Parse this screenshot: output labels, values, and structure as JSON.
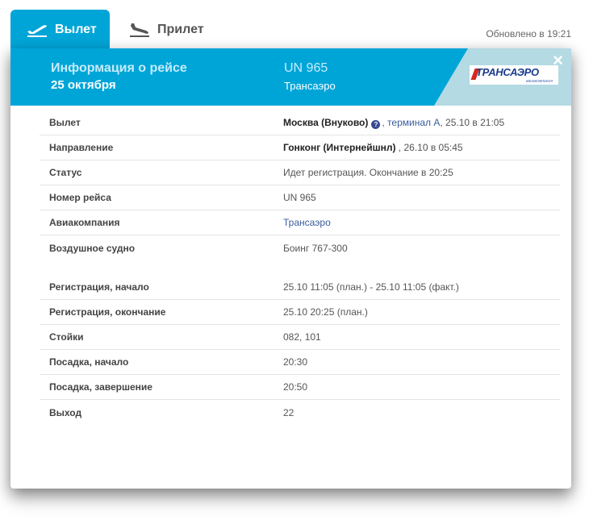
{
  "tabs": [
    {
      "label": "Вылет",
      "icon": "plane-takeoff-icon",
      "active": true
    },
    {
      "label": "Прилет",
      "icon": "plane-landing-icon",
      "active": false
    }
  ],
  "updated": "Обновлено в 19:21",
  "header": {
    "title": "Информация о рейсе",
    "date": "25 октября",
    "flight_number": "UN 965",
    "airline": "Трансаэро",
    "logo_text": "ТРАНСАЭРО",
    "logo_subtext": "авиакомпания",
    "close_icon": "close-icon"
  },
  "colors": {
    "accent": "#00a5d8",
    "header_light": "#b4dae4"
  },
  "details": {
    "departure": {
      "label": "Вылет",
      "airport": "Москва (Внуково)",
      "info_glyph": "?",
      "terminal": ", терминал А",
      "time": ", 25.10 в 21:05"
    },
    "destination": {
      "label": "Направление",
      "airport": "Гонконг (Интернейшнл)",
      "time": " , 26.10 в 05:45"
    },
    "status": {
      "label": "Статус",
      "value": "Идет регистрация. Окончание в 20:25"
    },
    "flight_number": {
      "label": "Номер рейса",
      "value": "UN 965"
    },
    "airline": {
      "label": "Авиакомпания",
      "value": "Трансаэро"
    },
    "aircraft": {
      "label": "Воздушное судно",
      "value": "Боинг 767-300"
    }
  },
  "checkin": {
    "start": {
      "label": "Регистрация, начало",
      "value": "25.10 11:05 (план.) - 25.10 11:05 (факт.)"
    },
    "end": {
      "label": "Регистрация, окончание",
      "value": "25.10 20:25 (план.)"
    },
    "counters": {
      "label": "Стойки",
      "value": "082, 101"
    },
    "boarding_start": {
      "label": "Посадка, начало",
      "value": "20:30"
    },
    "boarding_end": {
      "label": "Посадка, завершение",
      "value": "20:50"
    },
    "gate": {
      "label": "Выход",
      "value": "22"
    }
  }
}
